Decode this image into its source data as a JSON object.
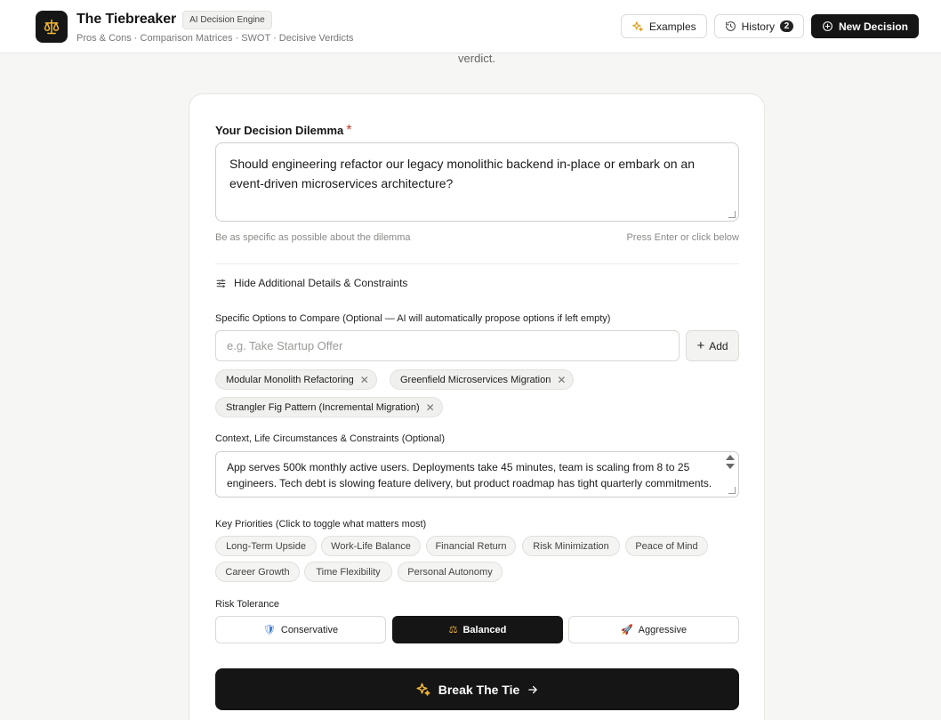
{
  "header": {
    "title": "The Tiebreaker",
    "badge": "AI Decision Engine",
    "subtitle": "Pros & Cons · Comparison Matrices · SWOT · Decisive Verdicts",
    "examples_label": "Examples",
    "history_label": "History",
    "history_count": "2",
    "new_decision_label": "New Decision"
  },
  "intro_tail": "verdict.",
  "form": {
    "dilemma_label": "Your Decision Dilemma",
    "required_mark": "*",
    "dilemma_value": "Should engineering refactor our legacy monolithic backend in-place or embark on an event-driven microservices architecture?",
    "hint_left": "Be as specific as possible about the dilemma",
    "hint_right": "Press Enter or click below",
    "toggle_details_label": "Hide Additional Details & Constraints",
    "options_label": "Specific Options to Compare (Optional — AI will automatically propose options if left empty)",
    "option_placeholder": "e.g. Take Startup Offer",
    "add_label": "Add",
    "options": [
      "Modular Monolith Refactoring",
      "Greenfield Microservices Migration",
      "Strangler Fig Pattern (Incremental Migration)"
    ],
    "context_label": "Context, Life Circumstances & Constraints (Optional)",
    "context_value": "App serves 500k monthly active users. Deployments take 45 minutes, team is scaling from 8 to 25 engineers. Tech debt is slowing feature delivery, but product roadmap has tight quarterly commitments.",
    "priorities_label": "Key Priorities (Click to toggle what matters most)",
    "priorities": [
      "Long-Term Upside",
      "Work-Life Balance",
      "Financial Return",
      "Risk Minimization",
      "Peace of Mind",
      "Career Growth",
      "Time Flexibility",
      "Personal Autonomy"
    ],
    "risk_label": "Risk Tolerance",
    "risk_options": [
      {
        "label": "Conservative",
        "icon": "🛡"
      },
      {
        "label": "Balanced",
        "icon": "⚖"
      },
      {
        "label": "Aggressive",
        "icon": "🚀"
      }
    ],
    "risk_selected": "Balanced",
    "submit_label": "Break The Tie"
  },
  "colors": {
    "primary": "#151515",
    "accent": "#f2b634",
    "required": "#c0392b"
  }
}
